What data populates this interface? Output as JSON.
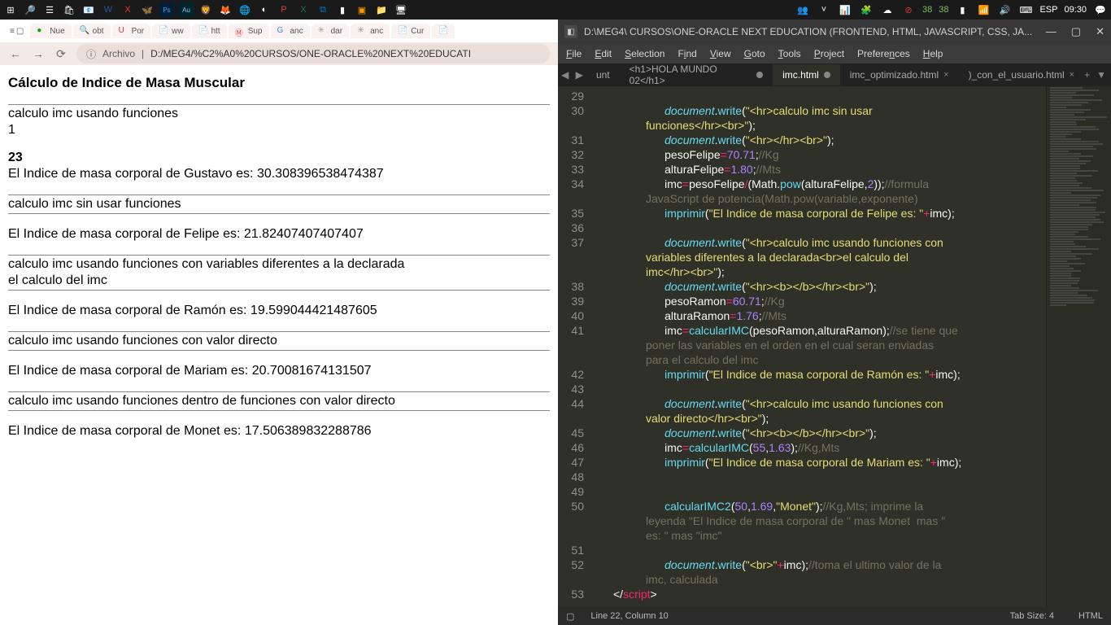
{
  "taskbar": {
    "left_icons": [
      "windows",
      "search",
      "taskview",
      "store",
      "mail",
      "word",
      "x",
      "butterfly",
      "ps",
      "au",
      "brave",
      "firefox",
      "edge",
      "cortana",
      "pp",
      "excel",
      "vscode",
      "cmd",
      "subl",
      "folder",
      "gpu"
    ],
    "right": {
      "badge1": "38",
      "badge2": "38",
      "lang": "ESP",
      "time": "09:30"
    }
  },
  "browser": {
    "tools": [
      "≡",
      "▢"
    ],
    "tabs": [
      {
        "ico": "🟢",
        "t": "Nue"
      },
      {
        "ico": "🔍",
        "t": "obt"
      },
      {
        "ico": "U",
        "t": "Por"
      },
      {
        "ico": "📄",
        "t": "ww"
      },
      {
        "ico": "📄",
        "t": "htt"
      },
      {
        "ico": "Ⓜ",
        "t": "Sup"
      },
      {
        "ico": "G",
        "t": "anc"
      },
      {
        "ico": "✳",
        "t": "dar"
      },
      {
        "ico": "✳",
        "t": "anc"
      },
      {
        "ico": "📄",
        "t": "Cur"
      },
      {
        "ico": "📄",
        "t": ""
      }
    ],
    "url_label": "Archivo",
    "url_sep": "|",
    "url": "D:/MEG4/%C2%A0%20CURSOS/ONE-ORACLE%20NEXT%20EDUCATI",
    "info_icon": "ⓘ",
    "nav": {
      "back": "←",
      "fwd": "→",
      "reload": "⟳"
    },
    "page": {
      "title": "Cálculo de Indice de Masa Muscular",
      "s1": "calculo imc usando funciones",
      "s1n": "1",
      "s1b": "23",
      "s1r": "El Indice de masa corporal de Gustavo es: 30.308396538474387",
      "s2": "calculo imc sin usar funciones",
      "s2r": "El Indice de masa corporal de Felipe es: 21.82407407407407",
      "s3a": "calculo imc usando funciones con variables diferentes a la declarada",
      "s3b": "el calculo del imc",
      "s3r": "El Indice de masa corporal de Ramón es: 19.599044421487605",
      "s4": "calculo imc usando funciones con valor directo",
      "s4r": "El Indice de masa corporal de Mariam es: 20.70081674131507",
      "s5": "calculo imc usando funciones dentro de funciones con valor directo",
      "s5r": "El Indice de masa corporal de Monet es: 17.506389832288786"
    }
  },
  "sublime": {
    "title": "D:\\MEG4\\  CURSOS\\ONE-ORACLE NEXT EDUCATION (FRONTEND, HTML, JAVASCRIPT, CSS, JA...",
    "menu": [
      "File",
      "Edit",
      "Selection",
      "Find",
      "View",
      "Goto",
      "Tools",
      "Project",
      "Preferences",
      "Help"
    ],
    "winbtns": {
      "min": "—",
      "max": "▢",
      "close": "✕"
    },
    "tabs": {
      "arrows": [
        "◀",
        "▶"
      ],
      "items": [
        {
          "label": "unt",
          "close": ""
        },
        {
          "label": "<h1>HOLA MUNDO 02</h1>",
          "dot": true
        },
        {
          "label": "imc.html",
          "dot": true,
          "active": true
        },
        {
          "label": "imc_optimizado.html",
          "x": true
        },
        {
          "label": ")_con_el_usuario.html",
          "x": true
        }
      ],
      "right": [
        "+",
        "▼"
      ]
    },
    "status": {
      "left": "Line 22, Column 10",
      "tab": "Tab Size: 4",
      "lang": "HTML",
      "sq": "▢"
    },
    "lines": [
      29,
      30,
      "",
      31,
      32,
      33,
      34,
      "",
      35,
      36,
      37,
      "",
      "",
      38,
      39,
      40,
      41,
      "",
      "",
      42,
      43,
      44,
      "",
      45,
      46,
      47,
      48,
      49,
      50,
      "",
      "",
      51,
      52,
      "",
      53
    ]
  }
}
